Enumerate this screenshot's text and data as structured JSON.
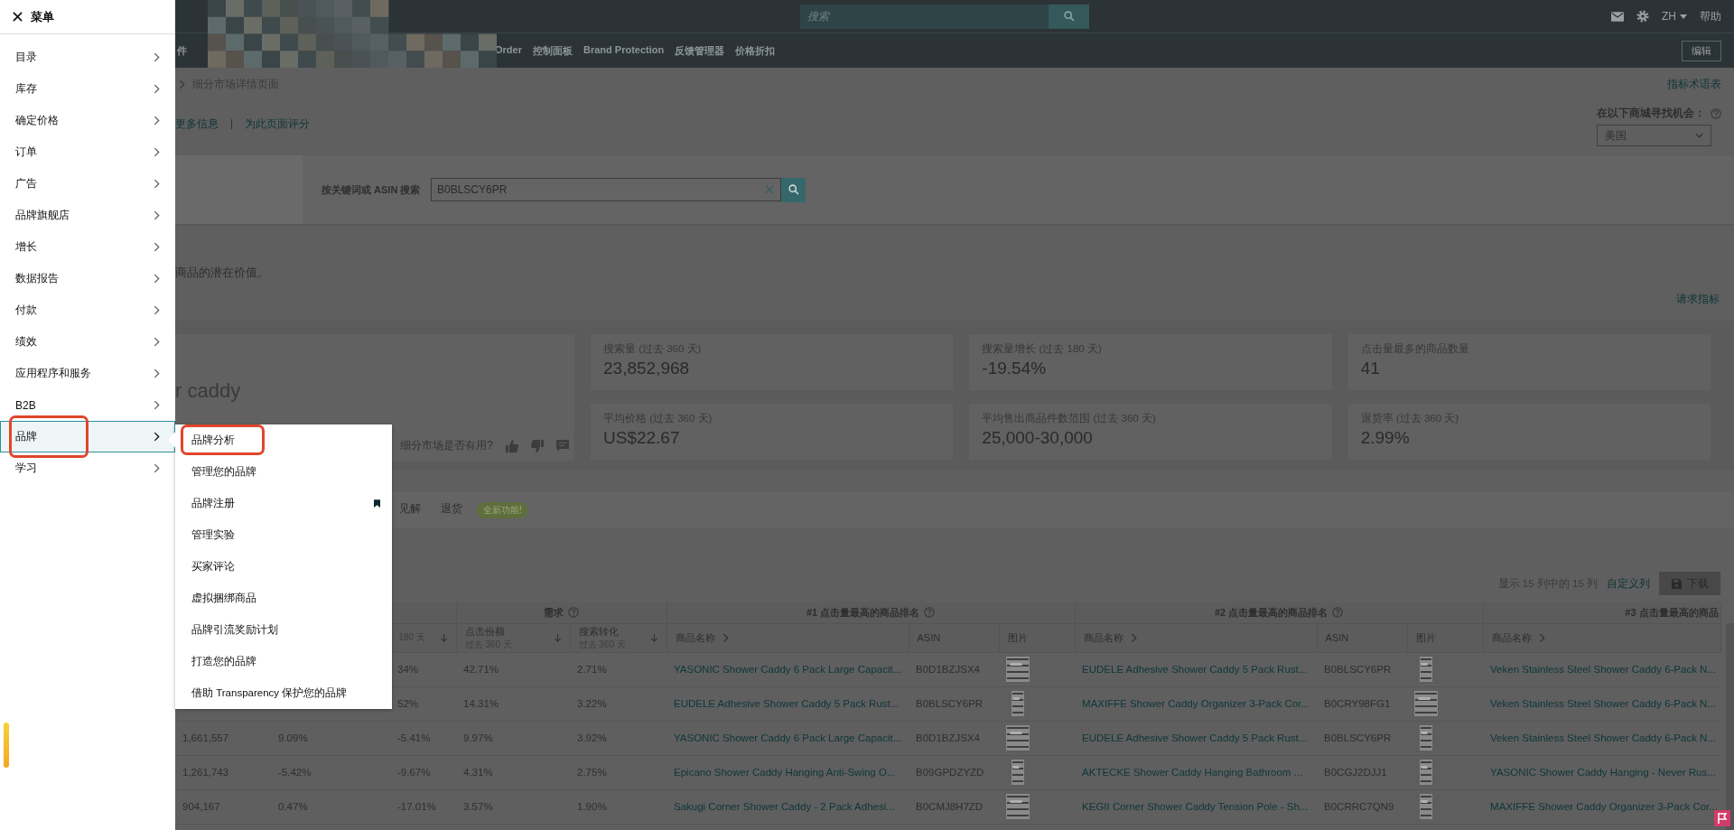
{
  "menu": {
    "title": "菜单",
    "items": [
      {
        "label": "目录",
        "selected": false,
        "annotated": false
      },
      {
        "label": "库存",
        "selected": false,
        "annotated": false
      },
      {
        "label": "确定价格",
        "selected": false,
        "annotated": false
      },
      {
        "label": "订单",
        "selected": false,
        "annotated": false
      },
      {
        "label": "广告",
        "selected": false,
        "annotated": false
      },
      {
        "label": "品牌旗舰店",
        "selected": false,
        "annotated": false
      },
      {
        "label": "增长",
        "selected": false,
        "annotated": false
      },
      {
        "label": "数据报告",
        "selected": false,
        "annotated": false
      },
      {
        "label": "付款",
        "selected": false,
        "annotated": false
      },
      {
        "label": "绩效",
        "selected": false,
        "annotated": false
      },
      {
        "label": "应用程序和服务",
        "selected": false,
        "annotated": false
      },
      {
        "label": "B2B",
        "selected": false,
        "annotated": false
      },
      {
        "label": "品牌",
        "selected": true,
        "annotated": true
      },
      {
        "label": "学习",
        "selected": false,
        "annotated": false
      }
    ],
    "submenu": {
      "items": [
        {
          "label": "品牌分析",
          "annotated": true,
          "bookmarked": false
        },
        {
          "label": "管理您的品牌",
          "annotated": false,
          "bookmarked": false
        },
        {
          "label": "品牌注册",
          "annotated": false,
          "bookmarked": true
        },
        {
          "label": "管理实验",
          "annotated": false,
          "bookmarked": false
        },
        {
          "label": "买家评论",
          "annotated": false,
          "bookmarked": false
        },
        {
          "label": "虚拟捆绑商品",
          "annotated": false,
          "bookmarked": false
        },
        {
          "label": "品牌引流奖励计划",
          "annotated": false,
          "bookmarked": false
        },
        {
          "label": "打造您的品牌",
          "annotated": false,
          "bookmarked": false
        },
        {
          "label": "借助 Transparency 保护您的品牌",
          "annotated": false,
          "bookmarked": false
        }
      ]
    }
  },
  "top_bar": {
    "search": {
      "placeholder": "搜索"
    },
    "language": "ZH",
    "help": "帮助"
  },
  "nav": {
    "fragment": "件",
    "items": [
      "Order",
      "控制面板",
      "Brand Protection",
      "反馈管理器",
      "价格折扣"
    ],
    "edit_button": "编辑"
  },
  "breadcrumb": "细分市场详情页面",
  "glossary_link": "指标术语表",
  "links": [
    "更多信息",
    "为此页面评分"
  ],
  "marketplace": {
    "label": "在以下商城寻找机会：",
    "value": "美国"
  },
  "search": {
    "label": "按关键词或 ASIN 搜索",
    "value": "B0BLSCY6PR"
  },
  "description": "商品的潜在价值。",
  "request_link": "请求指标",
  "niche": {
    "title": "r caddy",
    "feedback": "细分市场是否有用?"
  },
  "metrics": [
    {
      "label": "搜索量 (过去 360 天)",
      "value": "23,852,968"
    },
    {
      "label": "搜索量增长 (过去 180 天)",
      "value": "-19.54%"
    },
    {
      "label": "点击量最多的商品数量",
      "value": "41"
    },
    {
      "label": "平均价格 (过去 360 天)",
      "value": "US$22.67"
    },
    {
      "label": "平均售出商品件数范围 (过去 360 天)",
      "value": "25,000-30,000"
    },
    {
      "label": "退货率 (过去 360 天)",
      "value": "2.99%"
    }
  ],
  "tabs": [
    {
      "label": "见解",
      "selected": false
    },
    {
      "label": "退货",
      "selected": false,
      "badge": "全新功能!"
    }
  ],
  "table": {
    "summary": "显示 15 列中的 15 列",
    "customize_link": "自定义列",
    "download_button": "下载",
    "groups": [
      {
        "label": "需求",
        "help": true
      },
      {
        "label": "#1 点击量最高的商品排名",
        "help": true
      },
      {
        "label": "#2 点击量最高的商品排名",
        "help": true
      },
      {
        "label": "#3 点击量最高的商品",
        "help": false
      }
    ],
    "columns": [
      {
        "sublabel": "180 天",
        "sort": true
      },
      {
        "label": "点击份额",
        "sublabel": "过去 360 天",
        "sort": true
      },
      {
        "label": "搜索转化",
        "sublabel": "过去 360 天",
        "sort": true
      },
      {
        "label": "商品名称",
        "expand": true
      },
      {
        "label": "ASIN"
      },
      {
        "label": "图片"
      },
      {
        "label": "商品名称",
        "expand": true
      },
      {
        "label": "ASIN"
      },
      {
        "label": "图片"
      },
      {
        "label": "商品名称",
        "expand": true
      }
    ],
    "rows": [
      {
        "column_3": "34%",
        "click_share": "42.71%",
        "search_conversion": "2.71%",
        "top_1": {
          "name": "YASONIC Shower Caddy 6 Pack Large Capacit...",
          "asin": "B0D1BZJSX4"
        },
        "top_2": {
          "name": "EUDELE Adhesive Shower Caddy 5 Pack Rust...",
          "asin": "B0BLSCY6PR"
        },
        "top_3": {
          "name": "Veken Stainless Steel Shower Caddy 6-Pack N..."
        }
      },
      {
        "column_3": "52%",
        "click_share": "14.31%",
        "search_conversion": "3.22%",
        "top_1": {
          "name": "EUDELE Adhesive Shower Caddy 5 Pack Rust...",
          "asin": "B0BLSCY6PR"
        },
        "top_2": {
          "name": "MAXIFFE Shower Caddy Organizer 3-Pack Cor...",
          "asin": "B0CRY98FG1"
        },
        "top_3": {
          "name": "Veken Stainless Steel Shower Caddy 6-Pack N..."
        }
      },
      {
        "column_1": "1,661,557",
        "column_2": "9.09%",
        "column_3": "-5.41%",
        "click_share": "9.97%",
        "search_conversion": "3.92%",
        "top_1": {
          "name": "YASONIC Shower Caddy 6 Pack Large Capacit...",
          "asin": "B0D1BZJSX4"
        },
        "top_2": {
          "name": "EUDELE Adhesive Shower Caddy 5 Pack Rust...",
          "asin": "B0BLSCY6PR"
        },
        "top_3": {
          "name": "Veken Stainless Steel Shower Caddy 6-Pack N..."
        }
      },
      {
        "column_1": "1,261,743",
        "column_2": "-5.42%",
        "column_3": "-9.67%",
        "click_share": "4.31%",
        "search_conversion": "2.75%",
        "top_1": {
          "name": "Epicano Shower Caddy Hanging Anti-Swing O...",
          "asin": "B09GPDZYZD"
        },
        "top_2": {
          "name": "AKTECKE Shower Caddy Hanging Bathroom ...",
          "asin": "B0CGJ2DJJ1"
        },
        "top_3": {
          "name": "YASONIC Shower Caddy Hanging - Never Rus..."
        }
      },
      {
        "column_1": "904,167",
        "column_2": "0.47%",
        "column_3": "-17.01%",
        "click_share": "3.57%",
        "search_conversion": "1.90%",
        "top_1": {
          "name": "Sakugi Corner Shower Caddy - 2 Pack Adhesi...",
          "asin": "B0CMJ8H7ZD"
        },
        "top_2": {
          "name": "KEGII Corner Shower Caddy Tension Pole - Sh...",
          "asin": "B0CRRC7QN9"
        },
        "top_3": {
          "name": "MAXIFFE Shower Caddy Organizer 3-Pack Cor..."
        }
      }
    ]
  }
}
